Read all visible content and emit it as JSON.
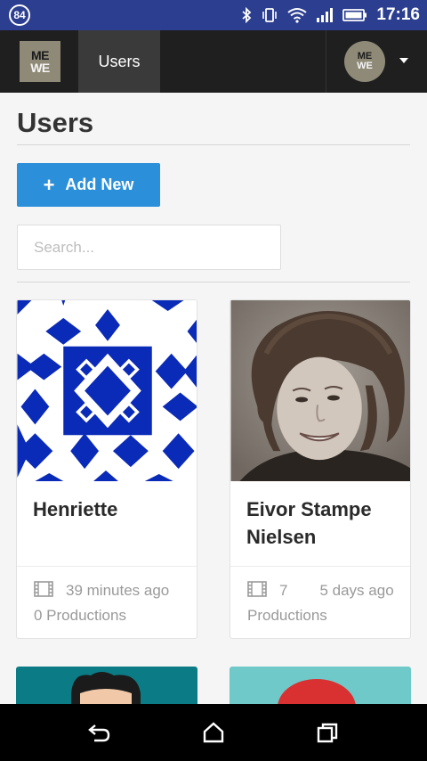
{
  "status_bar": {
    "badge": "84",
    "time": "17:16",
    "icons": [
      "bluetooth-icon",
      "vibrate-icon",
      "wifi-icon",
      "signal-icon",
      "battery-icon"
    ]
  },
  "topbar": {
    "logo_top": "ME",
    "logo_bottom": "WE",
    "nav_label": "Users",
    "avatar_top": "ME",
    "avatar_bottom": "WE"
  },
  "page": {
    "title": "Users",
    "add_button_label": "Add New",
    "search_placeholder": "Search..."
  },
  "users": [
    {
      "name": "Henriette",
      "productions_count": "",
      "updated": "39 minutes ago",
      "productions_line": "0 Productions",
      "image": "blue-geometric-pattern"
    },
    {
      "name": "Eivor Stampe Nielsen",
      "productions_count": "7",
      "updated": "5 days ago",
      "productions_line": "Productions",
      "image": "portrait-photo"
    }
  ],
  "colors": {
    "status_bar": "#2c3e8f",
    "topbar": "#1f1f1f",
    "accent": "#2b8fd9",
    "pattern_blue": "#0a2ab8"
  },
  "navigation_bar": {
    "icons": [
      "back-icon",
      "home-icon",
      "recents-icon"
    ]
  }
}
